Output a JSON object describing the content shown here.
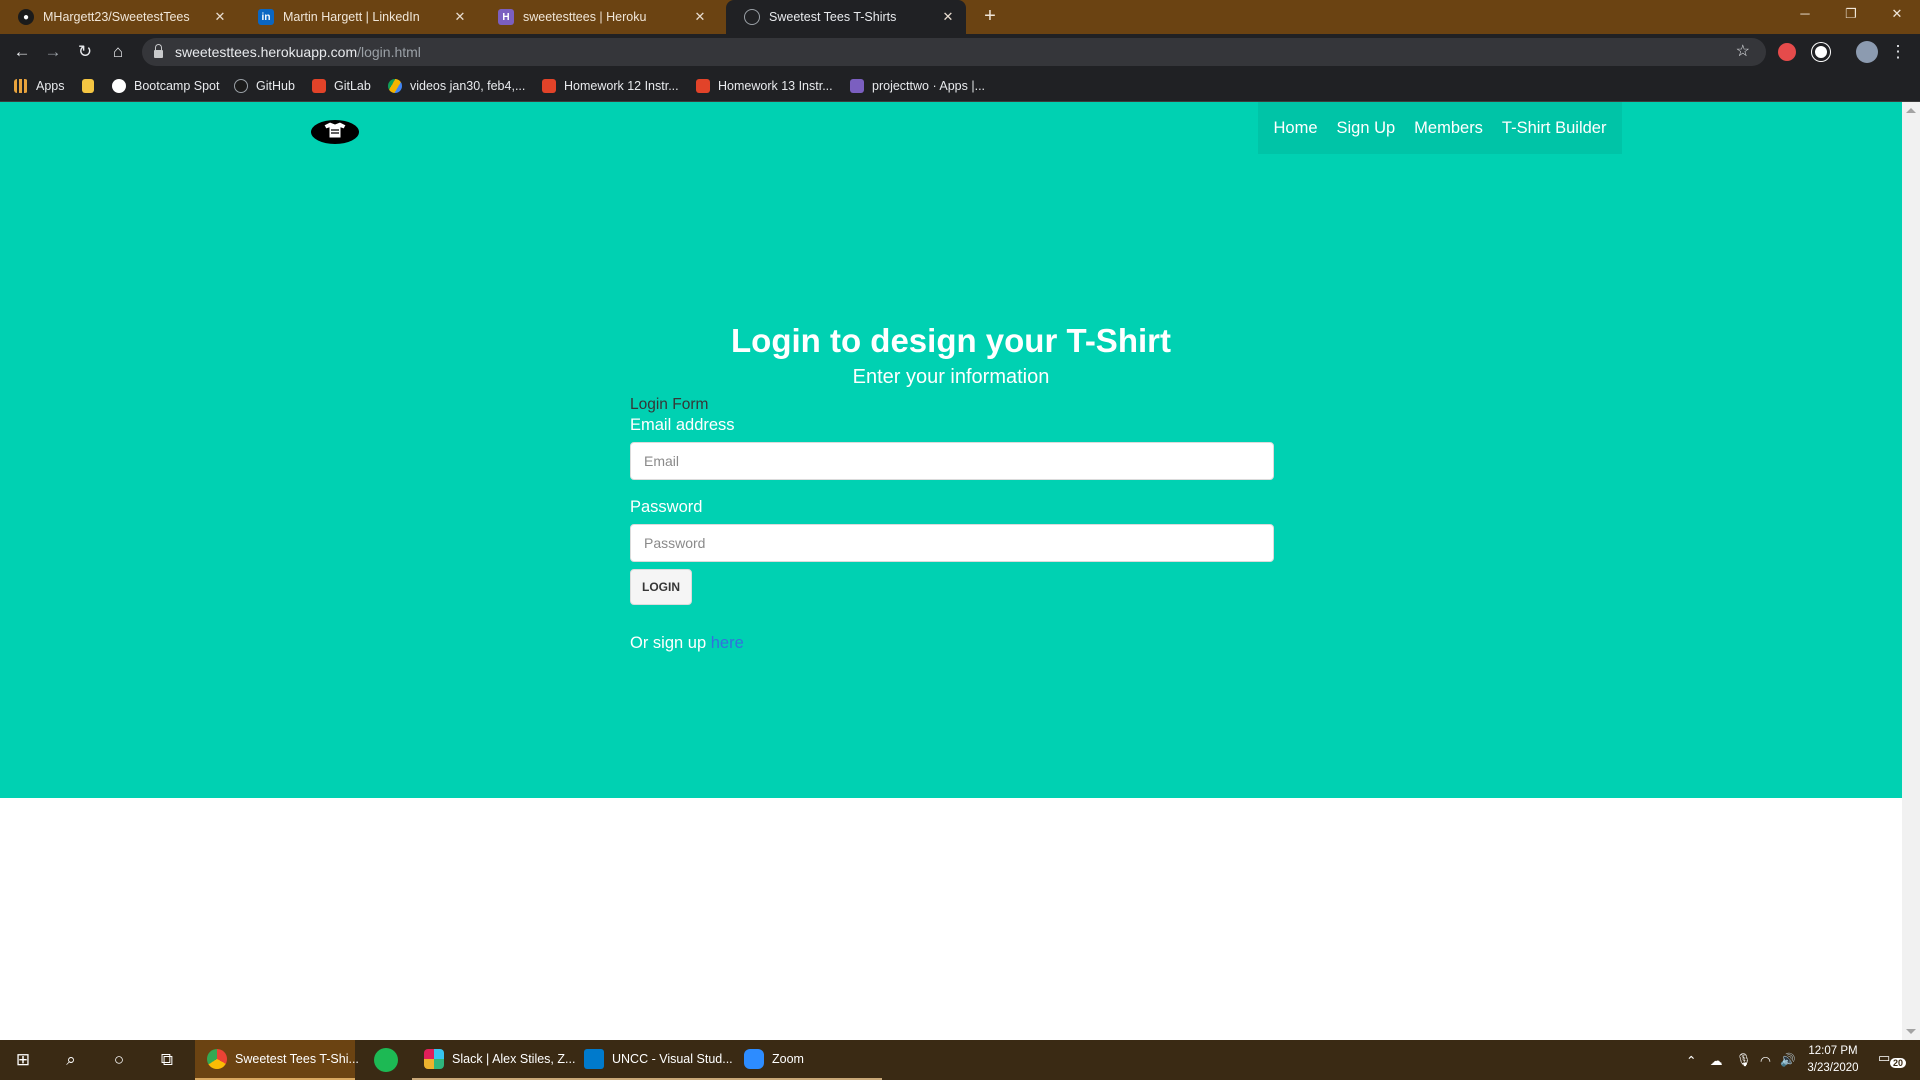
{
  "browser": {
    "tabs": [
      {
        "title": "MHargett23/SweetestTees",
        "icon": "github-icon"
      },
      {
        "title": "Martin Hargett | LinkedIn",
        "icon": "linkedin-icon"
      },
      {
        "title": "sweetesttees | Heroku",
        "icon": "heroku-icon"
      },
      {
        "title": "Sweetest Tees T-Shirts",
        "icon": "globe-icon"
      }
    ],
    "active_tab": 3,
    "url_host": "sweetesttees.herokuapp.com",
    "url_path": "/login.html",
    "bookmarks": [
      {
        "label": "Apps",
        "icon": "apps-grid-icon"
      },
      {
        "label": "",
        "icon": "folder-icon"
      },
      {
        "label": "Bootcamp Spot",
        "icon": "bootcamp-icon"
      },
      {
        "label": "GitHub",
        "icon": "github-icon"
      },
      {
        "label": "GitLab",
        "icon": "gitlab-icon"
      },
      {
        "label": "videos jan30, feb4,...",
        "icon": "drive-icon"
      },
      {
        "label": "Homework 12 Instr...",
        "icon": "gitlab-icon"
      },
      {
        "label": "Homework 13 Instr...",
        "icon": "gitlab-icon"
      },
      {
        "label": "projecttwo · Apps |...",
        "icon": "heroku-icon"
      }
    ]
  },
  "site": {
    "nav": [
      "Home",
      "Sign Up",
      "Members",
      "T-Shirt Builder"
    ],
    "heading": "Login to design your T-Shirt",
    "subheading": "Enter your information",
    "form": {
      "legend": "Login Form",
      "email_label": "Email address",
      "email_placeholder": "Email",
      "password_label": "Password",
      "password_placeholder": "Password",
      "login_button": "LOGIN",
      "signup_text": "Or sign up",
      "signup_link": "here"
    },
    "colors": {
      "primary": "#00d1b2",
      "nav": "#00c4a7",
      "link": "#3273dc"
    }
  },
  "taskbar": {
    "apps": [
      {
        "label": "Sweetest Tees T-Shi...",
        "icon": "chrome-icon",
        "state": "active"
      },
      {
        "label": "",
        "icon": "spotify-icon",
        "state": "closed"
      },
      {
        "label": "Slack | Alex Stiles, Z...",
        "icon": "slack-icon",
        "state": "open"
      },
      {
        "label": "UNCC - Visual Stud...",
        "icon": "vscode-icon",
        "state": "open"
      },
      {
        "label": "Zoom",
        "icon": "zoom-icon",
        "state": "open"
      }
    ],
    "time": "12:07 PM",
    "date": "3/23/2020",
    "notifications": "20"
  }
}
